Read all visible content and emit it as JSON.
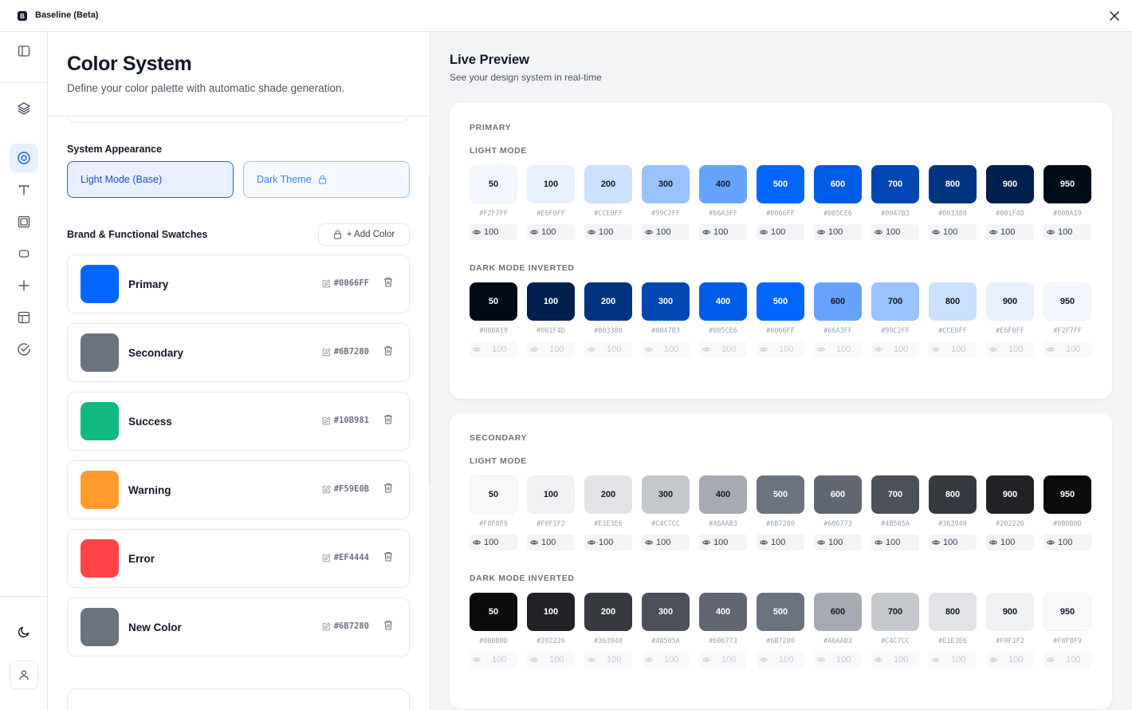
{
  "window": {
    "title": "Baseline (Beta)",
    "logo_letter": "B"
  },
  "left": {
    "title": "Color System",
    "subtitle": "Define your color palette with automatic shade generation.",
    "appearance_label": "System Appearance",
    "light_mode_label": "Light Mode (Base)",
    "dark_theme_label": "Dark Theme",
    "swatches_label": "Brand & Functional Swatches",
    "add_color_label": "+ Add Color",
    "swatches": [
      {
        "name": "Primary",
        "hex": "#0066FF",
        "color": "#0066ff"
      },
      {
        "name": "Secondary",
        "hex": "#6B7280",
        "color": "#6b7280"
      },
      {
        "name": "Success",
        "hex": "#10B981",
        "color": "#10b981"
      },
      {
        "name": "Warning",
        "hex": "#F59E0B",
        "color": "#ff9a2e"
      },
      {
        "name": "Error",
        "hex": "#EF4444",
        "color": "#ff4245"
      },
      {
        "name": "New Color",
        "hex": "#6B7280",
        "color": "#6b7280"
      }
    ]
  },
  "right": {
    "title": "Live Preview",
    "subtitle": "See your design system in real-time",
    "light_mode_label": "LIGHT MODE",
    "dark_mode_label": "DARK MODE INVERTED",
    "opacity_value": "100",
    "palettes": [
      {
        "name": "PRIMARY",
        "light": [
          {
            "label": "50",
            "hex": "#F2F7FF",
            "bg": "#f2f7ff",
            "fg": "#111827"
          },
          {
            "label": "100",
            "hex": "#E6F0FF",
            "bg": "#e6f0ff",
            "fg": "#111827"
          },
          {
            "label": "200",
            "hex": "#CCE0FF",
            "bg": "#cce0ff",
            "fg": "#111827"
          },
          {
            "label": "300",
            "hex": "#99C2FF",
            "bg": "#99c2ff",
            "fg": "#111827"
          },
          {
            "label": "400",
            "hex": "#66A3FF",
            "bg": "#66a3ff",
            "fg": "#111827"
          },
          {
            "label": "500",
            "hex": "#0066FF",
            "bg": "#0066ff",
            "fg": "#ffffff"
          },
          {
            "label": "600",
            "hex": "#005CE6",
            "bg": "#005ce6",
            "fg": "#ffffff"
          },
          {
            "label": "700",
            "hex": "#0047B3",
            "bg": "#0047b3",
            "fg": "#ffffff"
          },
          {
            "label": "800",
            "hex": "#003380",
            "bg": "#003380",
            "fg": "#ffffff"
          },
          {
            "label": "900",
            "hex": "#001F4D",
            "bg": "#001f4d",
            "fg": "#ffffff"
          },
          {
            "label": "950",
            "hex": "#000A19",
            "bg": "#000a19",
            "fg": "#ffffff"
          }
        ],
        "dark": [
          {
            "label": "50",
            "hex": "#000A19",
            "bg": "#000a19",
            "fg": "#ffffff"
          },
          {
            "label": "100",
            "hex": "#001F4D",
            "bg": "#001f4d",
            "fg": "#ffffff"
          },
          {
            "label": "200",
            "hex": "#003380",
            "bg": "#003380",
            "fg": "#ffffff"
          },
          {
            "label": "300",
            "hex": "#0047B3",
            "bg": "#0047b3",
            "fg": "#ffffff"
          },
          {
            "label": "400",
            "hex": "#005CE6",
            "bg": "#005ce6",
            "fg": "#ffffff"
          },
          {
            "label": "500",
            "hex": "#0066FF",
            "bg": "#0066ff",
            "fg": "#ffffff"
          },
          {
            "label": "600",
            "hex": "#66A3FF",
            "bg": "#66a3ff",
            "fg": "#111827"
          },
          {
            "label": "700",
            "hex": "#99C2FF",
            "bg": "#99c2ff",
            "fg": "#111827"
          },
          {
            "label": "800",
            "hex": "#CCE0FF",
            "bg": "#cce0ff",
            "fg": "#111827"
          },
          {
            "label": "900",
            "hex": "#E6F0FF",
            "bg": "#e6f0ff",
            "fg": "#111827"
          },
          {
            "label": "950",
            "hex": "#F2F7FF",
            "bg": "#f2f7ff",
            "fg": "#111827"
          }
        ]
      },
      {
        "name": "SECONDARY",
        "light": [
          {
            "label": "50",
            "hex": "#F8F8F9",
            "bg": "#f8f8f9",
            "fg": "#111827"
          },
          {
            "label": "100",
            "hex": "#F0F1F2",
            "bg": "#f0f1f2",
            "fg": "#111827"
          },
          {
            "label": "200",
            "hex": "#E1E3E6",
            "bg": "#e1e3e6",
            "fg": "#111827"
          },
          {
            "label": "300",
            "hex": "#C4C7CC",
            "bg": "#c4c7cc",
            "fg": "#111827"
          },
          {
            "label": "400",
            "hex": "#A6AAB3",
            "bg": "#a6aab3",
            "fg": "#111827"
          },
          {
            "label": "500",
            "hex": "#6B7280",
            "bg": "#6b7280",
            "fg": "#ffffff"
          },
          {
            "label": "600",
            "hex": "#606773",
            "bg": "#606773",
            "fg": "#ffffff"
          },
          {
            "label": "700",
            "hex": "#4B505A",
            "bg": "#4b505a",
            "fg": "#ffffff"
          },
          {
            "label": "800",
            "hex": "#363940",
            "bg": "#363940",
            "fg": "#ffffff"
          },
          {
            "label": "900",
            "hex": "#202226",
            "bg": "#202226",
            "fg": "#ffffff"
          },
          {
            "label": "950",
            "hex": "#0B0B0D",
            "bg": "#0b0b0d",
            "fg": "#ffffff"
          }
        ],
        "dark": [
          {
            "label": "50",
            "hex": "#0B0B0D",
            "bg": "#0b0b0d",
            "fg": "#ffffff"
          },
          {
            "label": "100",
            "hex": "#202226",
            "bg": "#202226",
            "fg": "#ffffff"
          },
          {
            "label": "200",
            "hex": "#363940",
            "bg": "#363940",
            "fg": "#ffffff"
          },
          {
            "label": "300",
            "hex": "#4B505A",
            "bg": "#4b505a",
            "fg": "#ffffff"
          },
          {
            "label": "400",
            "hex": "#606773",
            "bg": "#606773",
            "fg": "#ffffff"
          },
          {
            "label": "500",
            "hex": "#6B7280",
            "bg": "#6b7280",
            "fg": "#ffffff"
          },
          {
            "label": "600",
            "hex": "#A6AAB3",
            "bg": "#a6aab3",
            "fg": "#111827"
          },
          {
            "label": "700",
            "hex": "#C4C7CC",
            "bg": "#c4c7cc",
            "fg": "#111827"
          },
          {
            "label": "800",
            "hex": "#E1E3E6",
            "bg": "#e1e3e6",
            "fg": "#111827"
          },
          {
            "label": "900",
            "hex": "#F0F1F2",
            "bg": "#f0f1f2",
            "fg": "#111827"
          },
          {
            "label": "950",
            "hex": "#F8F8F9",
            "bg": "#f8f8f9",
            "fg": "#111827"
          }
        ]
      }
    ]
  }
}
